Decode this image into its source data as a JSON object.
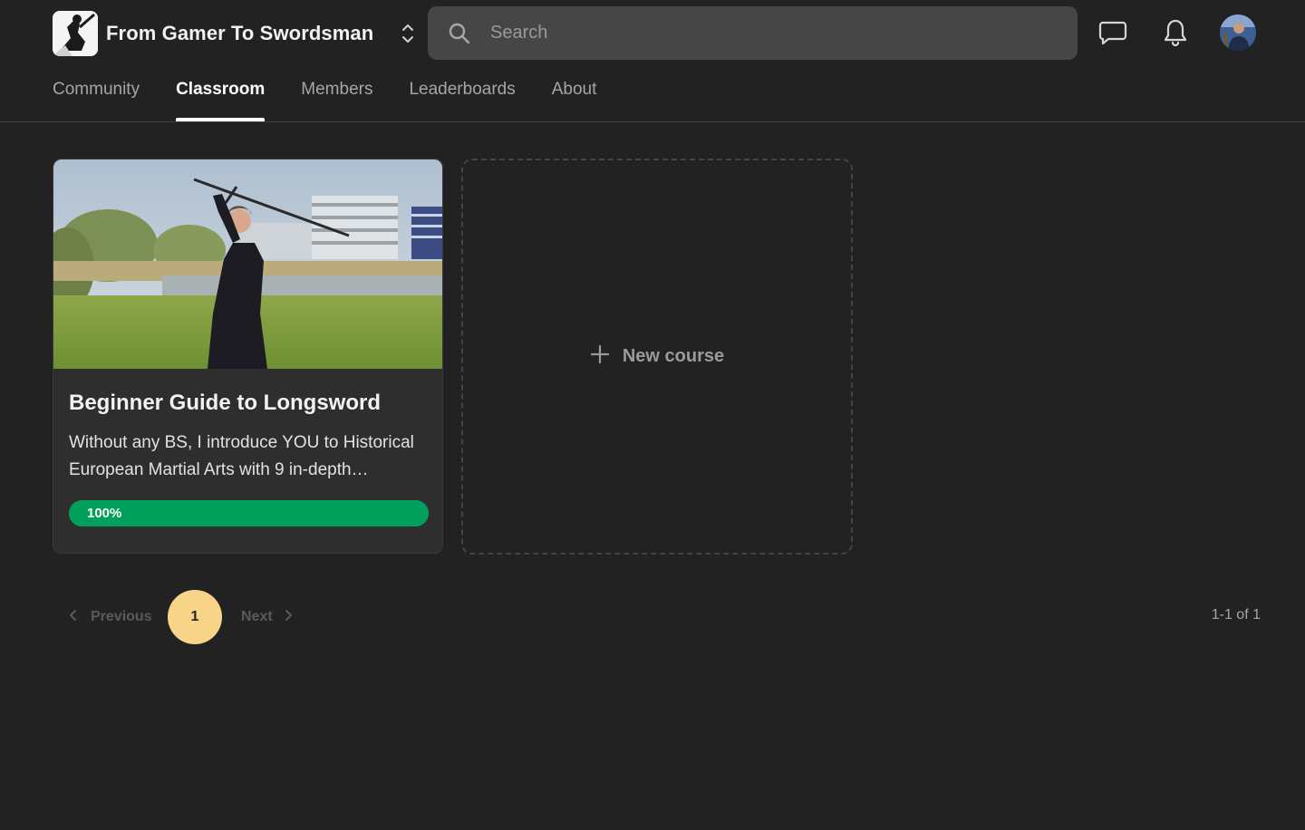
{
  "header": {
    "group_name": "From Gamer To Swordsman",
    "search_placeholder": "Search",
    "icons": {
      "switcher": "chevron-up-down-icon",
      "search": "search-icon",
      "chat": "chat-bubble-icon",
      "notifications": "bell-icon"
    }
  },
  "tabs": [
    {
      "label": "Community",
      "active": false
    },
    {
      "label": "Classroom",
      "active": true
    },
    {
      "label": "Members",
      "active": false
    },
    {
      "label": "Leaderboards",
      "active": false
    },
    {
      "label": "About",
      "active": false
    }
  ],
  "courses": [
    {
      "title": "Beginner Guide to Longsword",
      "description": "Without any BS, I introduce YOU to Historical European Martial Arts with 9 in-depth…",
      "progress_percent": 100,
      "progress_label": "100%"
    }
  ],
  "new_course": {
    "label": "New course"
  },
  "pagination": {
    "previous_label": "Previous",
    "next_label": "Next",
    "current_page": "1",
    "range_text": "1-1 of 1"
  },
  "colors": {
    "background": "#222222",
    "progress": "#00a05c",
    "active_page": "#f8d488"
  }
}
